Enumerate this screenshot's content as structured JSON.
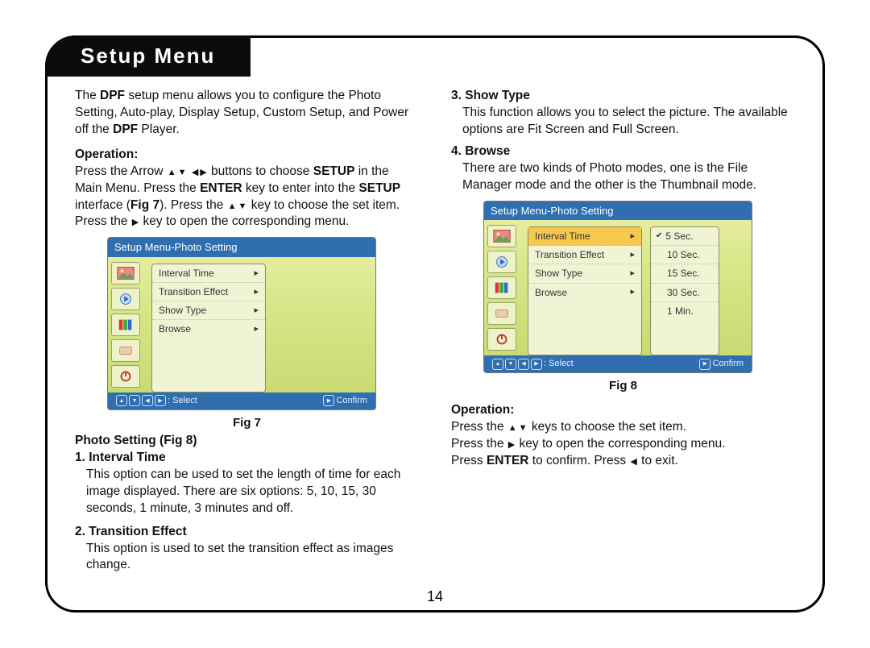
{
  "header": {
    "title": "Setup Menu"
  },
  "intro": {
    "pre": "The ",
    "b1": "DPF",
    "mid": " setup menu allows you to configure the Photo Setting, Auto-play, Display Setup, Custom Setup, and Power off the ",
    "b2": "DPF",
    "post": " Player."
  },
  "op_left": {
    "heading": "Operation:",
    "l1a": "Press the Arrow ",
    "l1b": " buttons to choose ",
    "b_setup": "SETUP",
    "l1c": " in the Main Menu. Press the ",
    "b_enter": "ENTER",
    "l1d": " key to enter into the ",
    "l1e": " interface (",
    "b_fig7": "Fig 7",
    "l1f": "). Press the ",
    "l1g": " key to choose the set item. Press the ",
    "l1h": " key to open the corresponding menu."
  },
  "fig7": {
    "title": "Setup Menu-Photo Setting",
    "rows": [
      "Interval Time",
      "Transition Effect",
      "Show Type",
      "Browse"
    ],
    "foot_select": ": Select",
    "foot_confirm": "Confirm",
    "caption": "Fig 7"
  },
  "photo_setting": {
    "heading": "Photo Setting (Fig 8)",
    "item1_h": "1. Interval Time",
    "item1_t": "This option can be used to set the length of time for each image displayed. There are six options: 5, 10, 15, 30 seconds, 1 minute, 3 minutes and off.",
    "item2_h": "2. Transition Effect",
    "item2_t": "This option is used to set the transition effect as images change."
  },
  "right": {
    "item3_h": "3. Show Type",
    "item3_t": "This function allows you to select the picture. The available options are Fit Screen and Full Screen.",
    "item4_h": "4. Browse",
    "item4_t": "There are two kinds of Photo modes, one is the File Manager mode and the other is the Thumbnail mode."
  },
  "fig8": {
    "title": "Setup Menu-Photo Setting",
    "rows": [
      "Interval Time",
      "Transition Effect",
      "Show Type",
      "Browse"
    ],
    "sub": [
      "5 Sec.",
      "10 Sec.",
      "15 Sec.",
      "30 Sec.",
      "1 Min."
    ],
    "foot_select": ": Select",
    "foot_confirm": "Confirm",
    "caption": "Fig 8"
  },
  "op_right": {
    "heading": "Operation:",
    "l1": "Press the ",
    "l1b": " keys to choose the set item.",
    "l2": "Press the ",
    "l2b": " key to open the corresponding menu.",
    "l3a": "Press ",
    "b_enter": "ENTER",
    "l3b": " to confirm. Press ",
    "l3c": " to exit."
  },
  "pagenum": "14"
}
